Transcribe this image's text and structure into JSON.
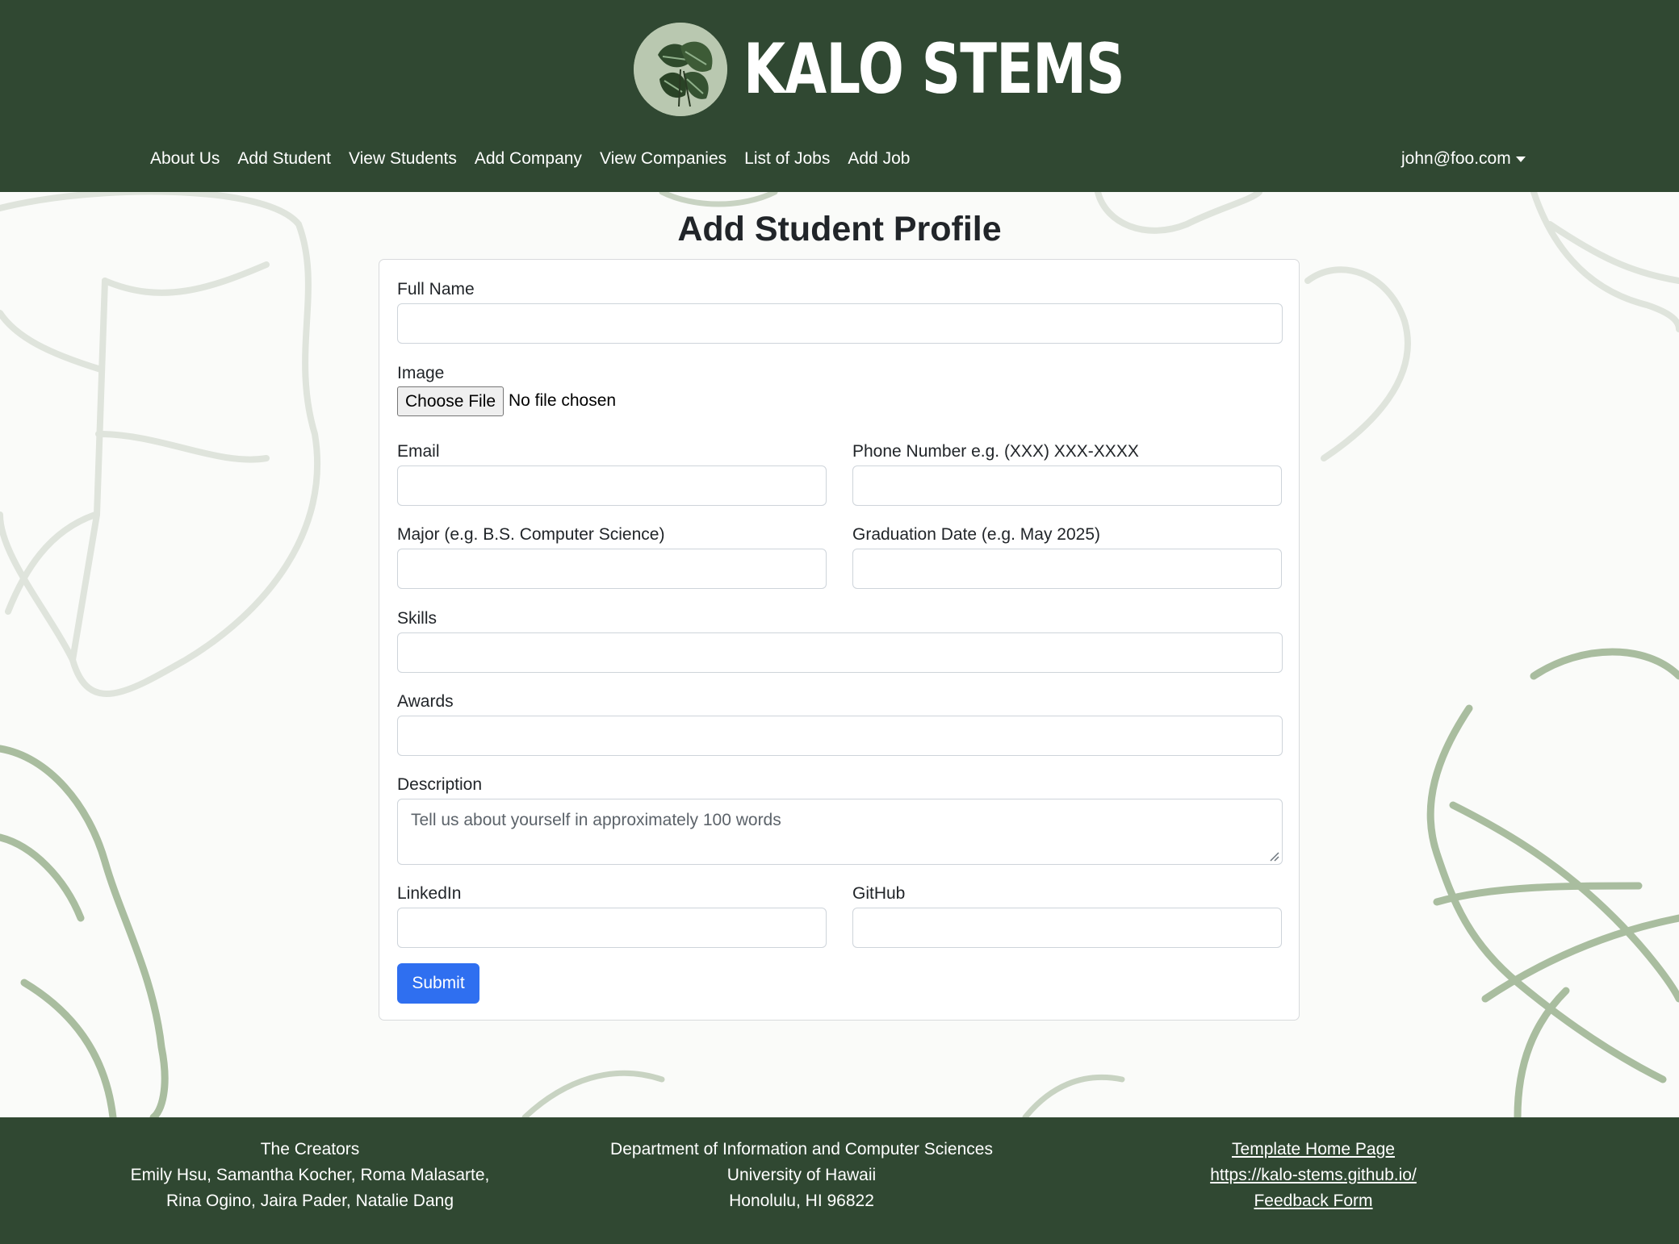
{
  "brand": {
    "title": "KALO STEMS"
  },
  "nav": {
    "items": [
      {
        "label": "About Us"
      },
      {
        "label": "Add Student"
      },
      {
        "label": "View Students"
      },
      {
        "label": "Add Company"
      },
      {
        "label": "View Companies"
      },
      {
        "label": "List of Jobs"
      },
      {
        "label": "Add Job"
      }
    ],
    "user": "john@foo.com"
  },
  "page": {
    "title": "Add Student Profile"
  },
  "form": {
    "full_name": {
      "label": "Full Name",
      "value": ""
    },
    "image": {
      "label": "Image",
      "button": "Choose File",
      "status": "No file chosen"
    },
    "email": {
      "label": "Email",
      "value": ""
    },
    "phone": {
      "label": "Phone Number e.g. (XXX) XXX-XXXX",
      "value": ""
    },
    "major": {
      "label": "Major (e.g. B.S. Computer Science)",
      "value": ""
    },
    "graduation": {
      "label": "Graduation Date (e.g. May 2025)",
      "value": ""
    },
    "skills": {
      "label": "Skills",
      "value": ""
    },
    "awards": {
      "label": "Awards",
      "value": ""
    },
    "description": {
      "label": "Description",
      "placeholder": "Tell us about yourself in approximately 100 words",
      "value": ""
    },
    "linkedin": {
      "label": "LinkedIn",
      "value": ""
    },
    "github": {
      "label": "GitHub",
      "value": ""
    },
    "submit": "Submit"
  },
  "footer": {
    "creators": {
      "heading": "The Creators",
      "line1": "Emily Hsu, Samantha Kocher, Roma Malasarte,",
      "line2": "Rina Ogino, Jaira Pader, Natalie Dang"
    },
    "department": {
      "line1": "Department of Information and Computer Sciences",
      "line2": "University of Hawaii",
      "line3": "Honolulu, HI 96822"
    },
    "links": {
      "template": "Template Home Page",
      "site": "https://kalo-stems.github.io/",
      "feedback": "Feedback Form"
    }
  },
  "colors": {
    "header_bg": "#304832",
    "footer_bg": "#304832",
    "accent": "#2f6ff0",
    "leaf_outline": "#a9bd9f"
  }
}
